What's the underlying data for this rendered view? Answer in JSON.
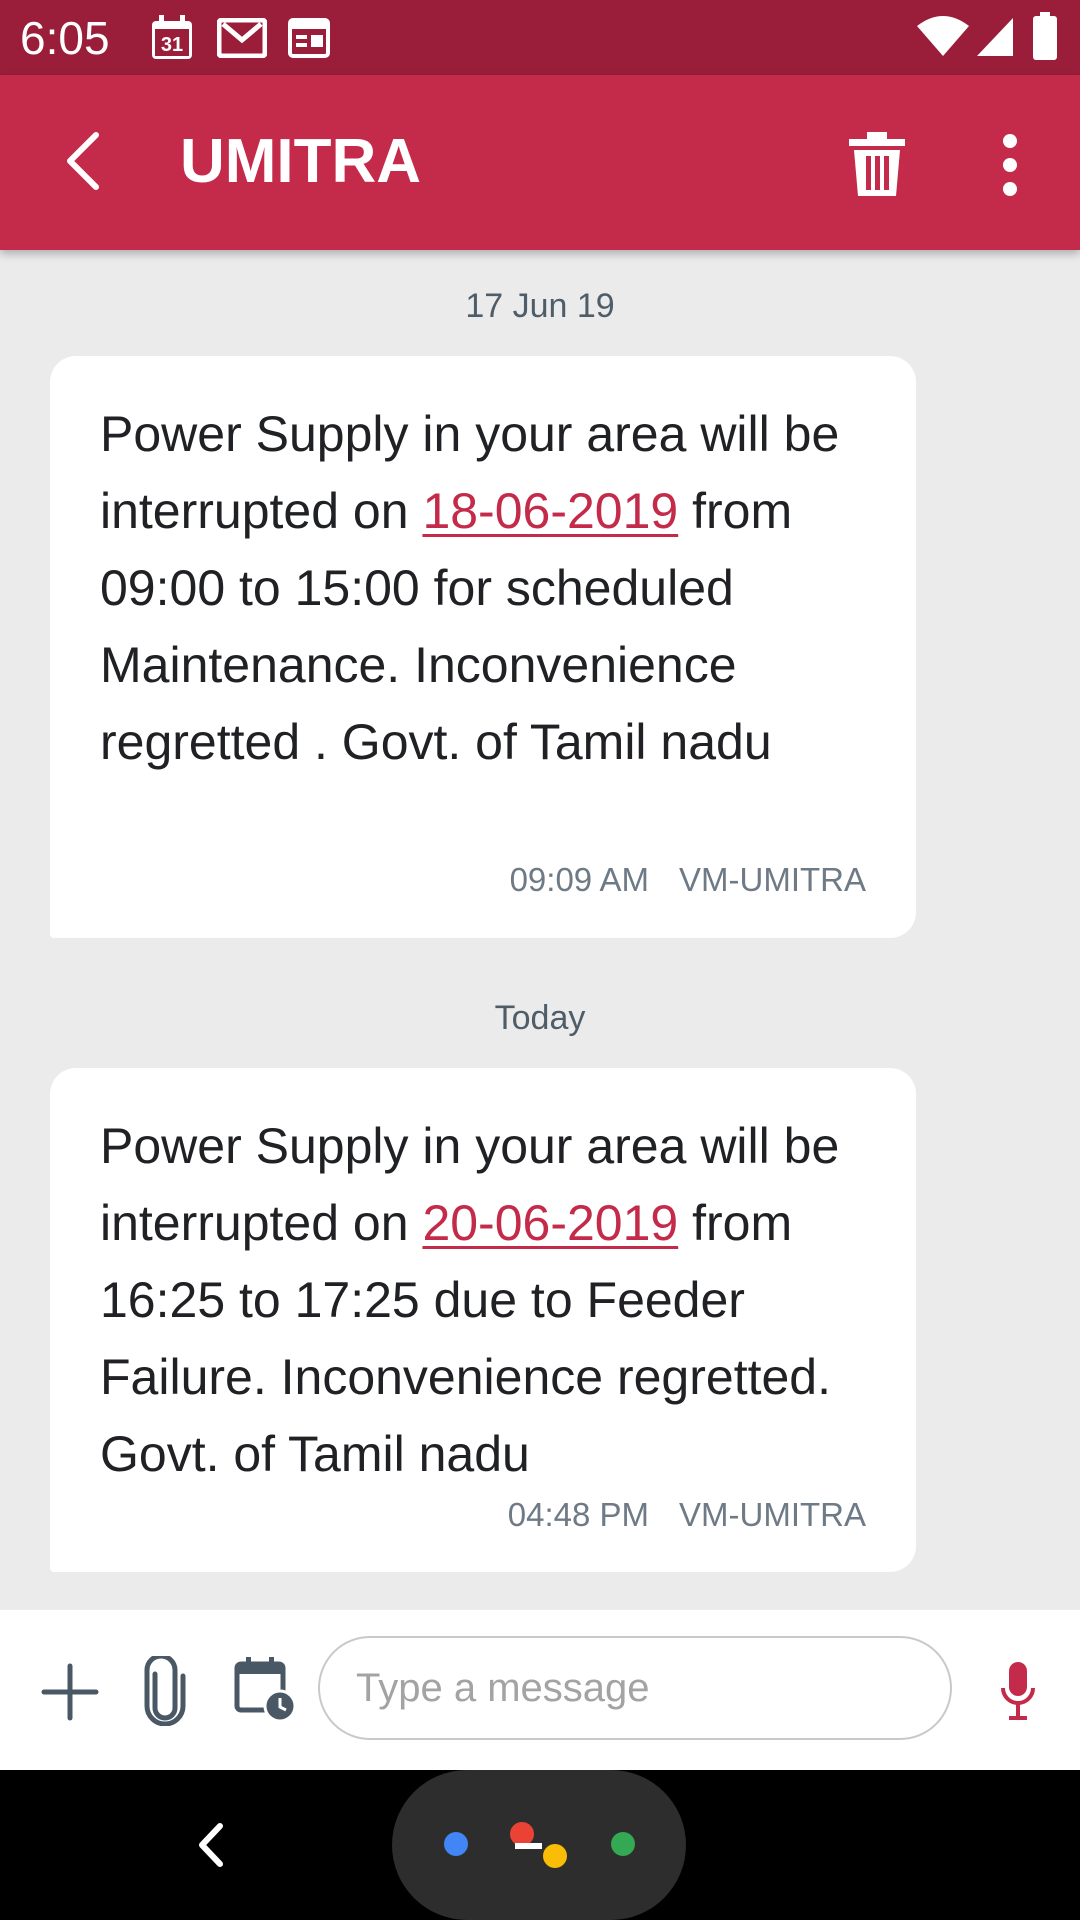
{
  "status_bar": {
    "time": "6:05",
    "calendar_day": "31",
    "icons": [
      "calendar-icon",
      "gmail-icon",
      "news-icon",
      "wifi-icon",
      "signal-icon",
      "battery-icon"
    ]
  },
  "app_bar": {
    "title": "UMITRA",
    "icons": [
      "back-arrow-icon",
      "delete-icon",
      "more-vert-icon"
    ]
  },
  "conversation": {
    "groups": [
      {
        "date_label": "17 Jun 19",
        "message": {
          "text_before": "Power Supply in your area will be interrupted on ",
          "link": "18-06-2019",
          "text_after": " from 09:00 to 15:00 for scheduled Maintenance. Inconvenience regretted . Govt. of Tamil nadu",
          "time": "09:09 AM",
          "sender": "VM-UMITRA"
        }
      },
      {
        "date_label": "Today",
        "message": {
          "text_before": "Power Supply in your area will be interrupted on ",
          "link": "20-06-2019",
          "text_after": " from 16:25 to 17:25 due to Feeder Failure. Inconvenience regretted. Govt. of Tamil nadu",
          "time": "04:48 PM",
          "sender": "VM-UMITRA"
        }
      }
    ]
  },
  "compose": {
    "placeholder": "Type a message",
    "value": "",
    "icons": [
      "add-icon",
      "attachment-icon",
      "schedule-send-icon",
      "mic-icon"
    ]
  },
  "colors": {
    "status_bar": "#9a1e3a",
    "app_bar": "#c42a49",
    "accent": "#c42a49",
    "background": "#ebebeb"
  }
}
